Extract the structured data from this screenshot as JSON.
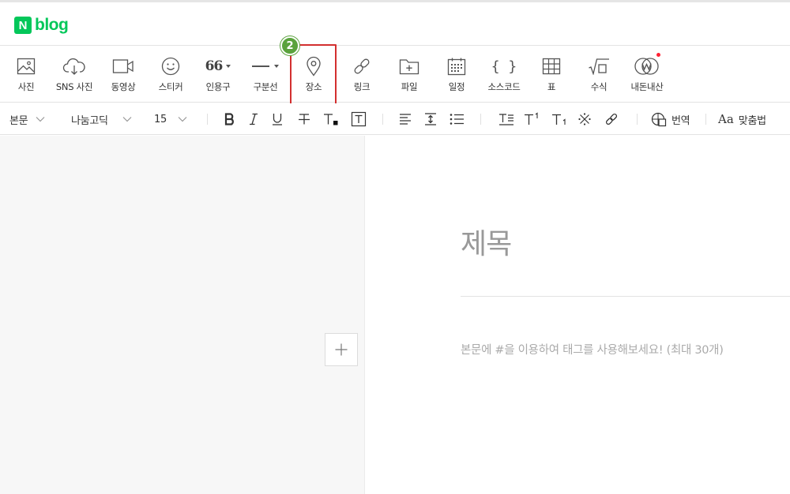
{
  "header": {
    "logo_badge": "N",
    "logo_text": "blog"
  },
  "toolbar": {
    "items": [
      {
        "label": "사진"
      },
      {
        "label": "SNS 사진"
      },
      {
        "label": "동영상"
      },
      {
        "label": "스티커"
      },
      {
        "label": "인용구",
        "glyph": "66"
      },
      {
        "label": "구분선"
      },
      {
        "label": "장소"
      },
      {
        "label": "링크"
      },
      {
        "label": "파일"
      },
      {
        "label": "일정"
      },
      {
        "label": "소스코드",
        "glyph": "{ }"
      },
      {
        "label": "표"
      },
      {
        "label": "수식"
      },
      {
        "label": "내돈내산"
      }
    ],
    "step_badge": "2",
    "accent": "#03c75a",
    "highlight_color": "#d32f2f"
  },
  "formatbar": {
    "paragraph_style": "본문",
    "font": "나눔고딕",
    "font_size": "15",
    "translate_label": "번역",
    "spellcheck_label": "맞춤법"
  },
  "editor": {
    "title_placeholder": "제목",
    "body_placeholder": "본문에 #을 이용하여 태그를 사용해보세요! (최대 30개)"
  }
}
